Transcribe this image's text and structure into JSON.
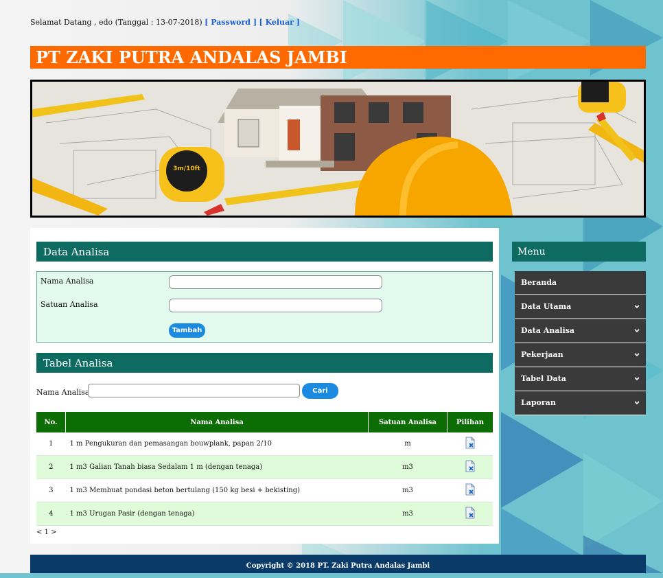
{
  "header": {
    "welcome_text": "Selamat Datang , edo (Tanggal : 13-07-2018)",
    "password_link": "[ Password ]",
    "logout_link": "[ Keluar ]",
    "brand": "PT ZAKI PUTRA ANDALAS JAMBI"
  },
  "banner": {
    "tape_label": "3m/10ft"
  },
  "data_analisa": {
    "title": "Data Analisa",
    "nama_label": "Nama Analisa",
    "nama_value": "",
    "satuan_label": "Satuan Analisa",
    "satuan_value": "",
    "add_button": "Tambah"
  },
  "tabel_analisa": {
    "title": "Tabel Analisa",
    "search_label": "Nama Analisa :",
    "search_value": "",
    "search_button": "Cari",
    "columns": [
      "No.",
      "Nama Analisa",
      "Satuan Analisa",
      "Pilihan"
    ],
    "rows": [
      {
        "no": "1",
        "nama": "1 m Pengukuran dan pemasangan bouwplank, papan 2/10",
        "satuan": "m"
      },
      {
        "no": "2",
        "nama": "1 m3 Galian Tanah biasa Sedalam 1 m (dengan tenaga)",
        "satuan": "m3"
      },
      {
        "no": "3",
        "nama": "1 m3 Membuat pondasi beton bertulang (150 kg besi + bekisting)",
        "satuan": "m3"
      },
      {
        "no": "4",
        "nama": "1 m3 Urugan Pasir (dengan tenaga)",
        "satuan": "m3"
      }
    ],
    "pagination": "< 1 >"
  },
  "menu": {
    "title": "Menu",
    "items": [
      {
        "label": "Beranda",
        "has_sub": false
      },
      {
        "label": "Data Utama",
        "has_sub": true
      },
      {
        "label": "Data Analisa",
        "has_sub": true
      },
      {
        "label": "Pekerjaan",
        "has_sub": true
      },
      {
        "label": "Tabel Data",
        "has_sub": true
      },
      {
        "label": "Laporan",
        "has_sub": true
      }
    ],
    "chevron_icon": "chevron-down-icon"
  },
  "footer": {
    "copyright": "Copyright © 2018 PT. Zaki Putra Andalas Jambi"
  },
  "colors": {
    "brand_orange": "#ff6a00",
    "panel_teal": "#0d6b62",
    "table_header_green": "#0c6d04",
    "footer_navy": "#0a3a68",
    "menu_dark": "#3a3a3a",
    "button_blue": "#1a8be0"
  }
}
